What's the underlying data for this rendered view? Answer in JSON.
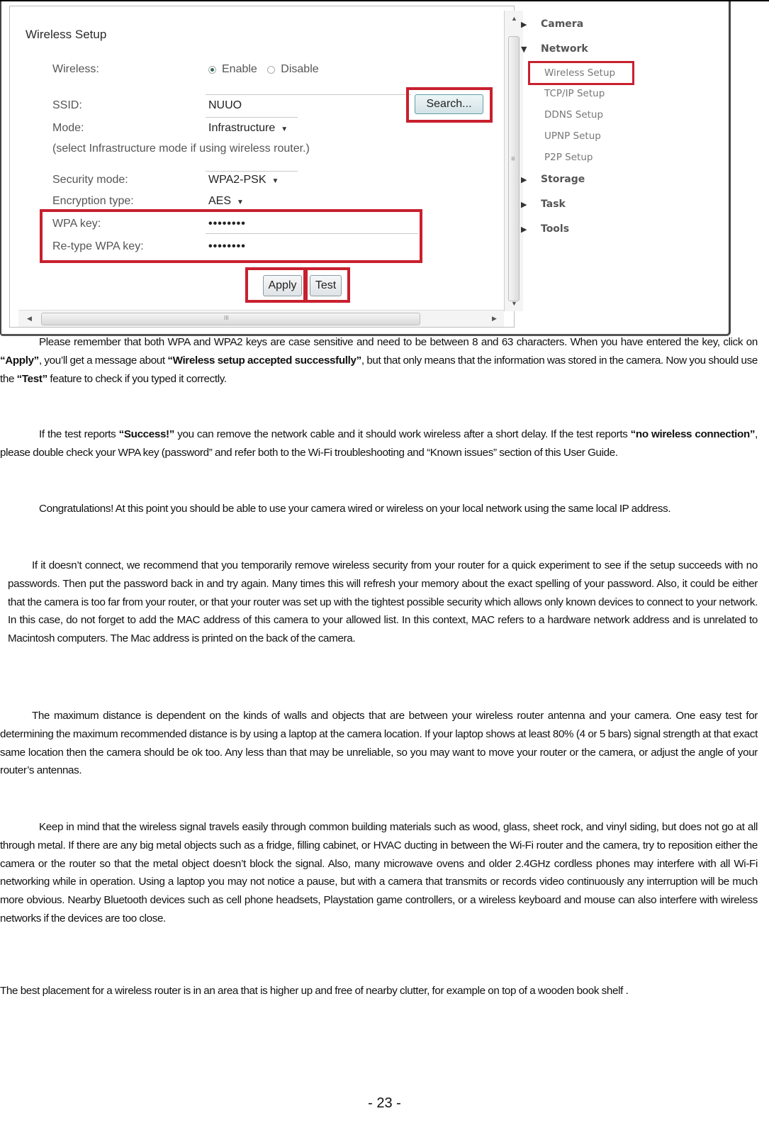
{
  "screenshot": {
    "panel_title": "Wireless Setup",
    "fields": {
      "wireless_label": "Wireless:",
      "wireless_options": [
        "Enable",
        "Disable"
      ],
      "wireless_selected": "Enable",
      "ssid_label": "SSID:",
      "ssid_value": "NUUO",
      "search_button": "Search...",
      "mode_label": "Mode:",
      "mode_value": "Infrastructure",
      "mode_note": "(select Infrastructure mode if using wireless router.)",
      "security_mode_label": "Security mode:",
      "security_mode_value": "WPA2-PSK",
      "encryption_label": "Encryption type:",
      "encryption_value": "AES",
      "wpa_key_label": "WPA key:",
      "wpa_key_value": "••••••••",
      "retype_label": "Re-type WPA key:",
      "retype_value": "••••••••",
      "apply_button": "Apply",
      "test_button": "Test"
    },
    "scroll_grip": "≡",
    "hscroll_grip": "III",
    "highlight_color": "#c8202e",
    "menu": {
      "items": [
        {
          "label": "Camera",
          "expanded": false
        },
        {
          "label": "Network",
          "expanded": true
        },
        {
          "label": "Storage",
          "expanded": false
        },
        {
          "label": "Task",
          "expanded": false
        },
        {
          "label": "Tools",
          "expanded": false
        }
      ],
      "network_sub": [
        "Wireless Setup",
        "TCP/IP Setup",
        "DDNS Setup",
        "UPNP Setup",
        "P2P Setup"
      ],
      "active_sub": "Wireless Setup"
    }
  },
  "document": {
    "paragraphs": [
      {
        "segments": [
          {
            "t": "Please remember that both WPA and WPA2 keys are case sensitive and need to be between 8 and 63 characters. When you have entered the key, click on "
          },
          {
            "t": "“Apply”",
            "b": true
          },
          {
            "t": ", you’ll get a message about "
          },
          {
            "t": "“Wireless setup accepted successfully”",
            "b": true
          },
          {
            "t": ", but that only means that the information was stored in the camera. Now you should use the "
          },
          {
            "t": "“Test”",
            "b": true
          },
          {
            "t": " feature to check if you typed it correctly."
          }
        ]
      },
      {
        "segments": [
          {
            "t": "If the test reports "
          },
          {
            "t": "“Success!”",
            "b": true
          },
          {
            "t": " you can remove the network cable and it should work wireless after a short delay. If the test reports "
          },
          {
            "t": "“no wireless connection”",
            "b": true
          },
          {
            "t": ", please double check your WPA key (password” and refer both to the Wi-Fi troubleshooting and “Known issues” section of this User Guide."
          }
        ]
      },
      {
        "segments": [
          {
            "t": "Congratulations! At this point you should be able to use your camera wired or wireless on your local network using the same local IP address."
          }
        ]
      },
      {
        "segments": [
          {
            "t": "If it doesn’t connect, we recommend that you temporarily remove wireless security from your router for a quick experiment to see if the setup succeeds with no passwords. Then put the password back in and try again. Many times this will refresh your memory about the exact spelling of your password. Also, it could be either that the camera is too far from your router, or that your router was set up with the tightest possible security which allows only known devices to connect to your network. In this case, do not forget to add the MAC address of this camera to your allowed list. In this context, MAC refers to a hardware network address and is unrelated to Macintosh computers. The Mac address is printed on the back of the camera."
          }
        ]
      },
      {
        "segments": [
          {
            "t": "The maximum distance is dependent on the kinds of walls and objects that are between your wireless router antenna and your camera. One easy test for determining the maximum recommended distance is by using a laptop at the camera location. If your laptop shows at least 80% (4 or 5 bars) signal strength at that exact same location then the camera should be ok too. Any less than that may be unreliable, so you may want to move your router or the camera, or adjust the angle of your router’s antennas."
          }
        ]
      },
      {
        "segments": [
          {
            "t": "Keep in mind that the wireless signal travels easily through common building materials such as wood, glass, sheet rock, and vinyl siding, but does not go at all through metal. If there are any big metal objects such as a fridge, filling cabinet, or HVAC ducting in between the Wi-Fi router and the camera, try to reposition either the camera or the router so that the metal object doesn’t block the signal. Also, many microwave ovens and older 2.4GHz cordless phones may interfere with all Wi-Fi networking while in operation. Using a laptop you may not notice a pause, but with a camera that transmits or records video continuously any interruption will be much more obvious. Nearby Bluetooth devices such as cell phone headsets, Playstation game controllers, or a wireless keyboard and mouse can also interfere with wireless networks if the devices are too close."
          }
        ]
      },
      {
        "segments": [
          {
            "t": "The best placement for a wireless router is in an area that is higher up and free of nearby clutter, for example on top of a wooden book shelf ."
          }
        ]
      }
    ],
    "page_number": "- 23 -"
  }
}
